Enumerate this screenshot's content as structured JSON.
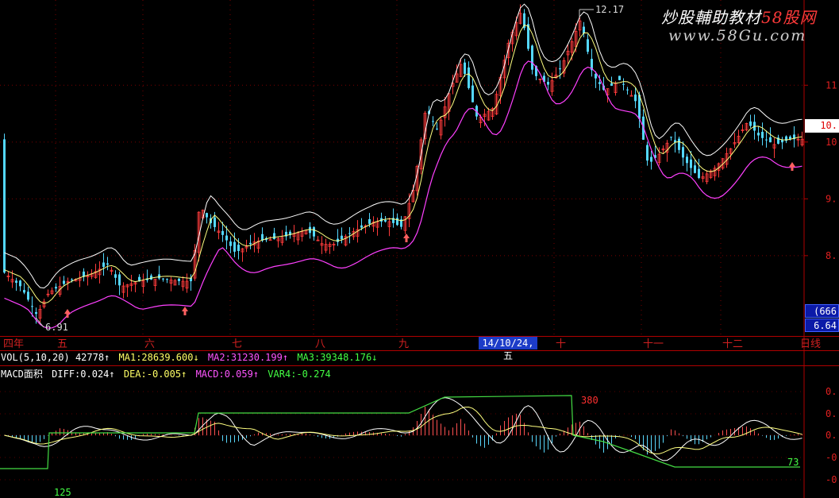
{
  "watermark": {
    "title_prefix": "炒股輔助教材",
    "title_brand": "58股网",
    "url": "www.58Gu.com"
  },
  "price_chart": {
    "price_axis_labels": [
      "11.",
      "10.",
      "9.",
      "8."
    ],
    "price_axis_values": [
      11,
      10,
      9,
      8
    ],
    "high_label": "12.17",
    "low_label": "6.91",
    "current_price_tag": "10.",
    "y_range": [
      6.6,
      12.5
    ],
    "month_labels": [
      "四年",
      "五",
      "六",
      "七",
      "八",
      "九",
      "十",
      "十一",
      "十二",
      "日线"
    ],
    "cursor_date": "14/10/24,五",
    "right_box_top": "(666",
    "right_box_bottom": "6.64",
    "colors": {
      "up": "#ff3b3b",
      "down": "#54d8ff",
      "ma1": "#ffffff",
      "ma2": "#ffff80",
      "ma3": "#ff40ff",
      "grid": "#7a0000",
      "arrow": "#ff6060"
    }
  },
  "vol_bar": {
    "name": "VOL(5,10,20)",
    "value": "42778",
    "value_arrow": "↑",
    "ma1": "MA1:28639.600",
    "ma1_arrow": "↓",
    "ma2": "MA2:31230.199",
    "ma2_arrow": "↑",
    "ma3": "MA3:39348.176",
    "ma3_arrow": "↓"
  },
  "macd_bar": {
    "name": "MACD面积",
    "diff": "DIFF:0.024",
    "diff_arrow": "↑",
    "dea": "DEA:-0.005",
    "dea_arrow": "↑",
    "macd": "MACD:0.059",
    "macd_arrow": "↑",
    "var4": "VAR4:-0.274",
    "axis_labels": [
      "0.",
      "0.",
      "0.",
      "-0.",
      "-0."
    ],
    "area_labels": [
      "125",
      "73",
      "380"
    ]
  }
}
